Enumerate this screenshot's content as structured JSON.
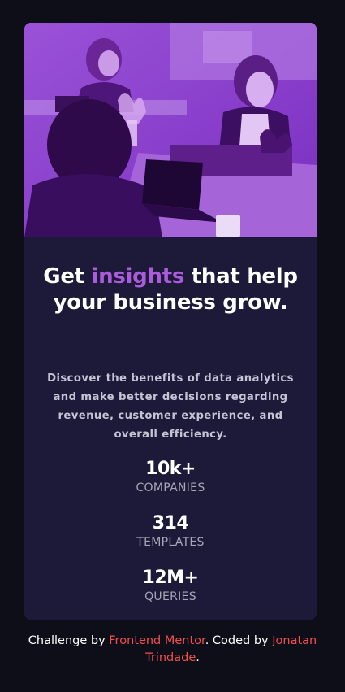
{
  "card": {
    "headline": {
      "before": "Get ",
      "accent": "insights",
      "after": " that help your business grow."
    },
    "description": "Discover the benefits of data analytics and make better decisions regarding revenue, customer experience, and overall efficiency.",
    "stats": [
      {
        "value": "10k+",
        "label": "COMPANIES"
      },
      {
        "value": "314",
        "label": "TEMPLATES"
      },
      {
        "value": "12M+",
        "label": "QUERIES"
      }
    ]
  },
  "footer": {
    "prefix": "Challenge by ",
    "challenge_link": "Frontend Mentor",
    "middle": ". Coded by ",
    "author_link": "Jonatan Trindade",
    "suffix": "."
  },
  "colors": {
    "page_background": "#0e0e19",
    "card_background": "#1c1a38",
    "accent": "#aa5cdb",
    "link": "#f24e4e",
    "muted_text": "#a7a5b7"
  }
}
